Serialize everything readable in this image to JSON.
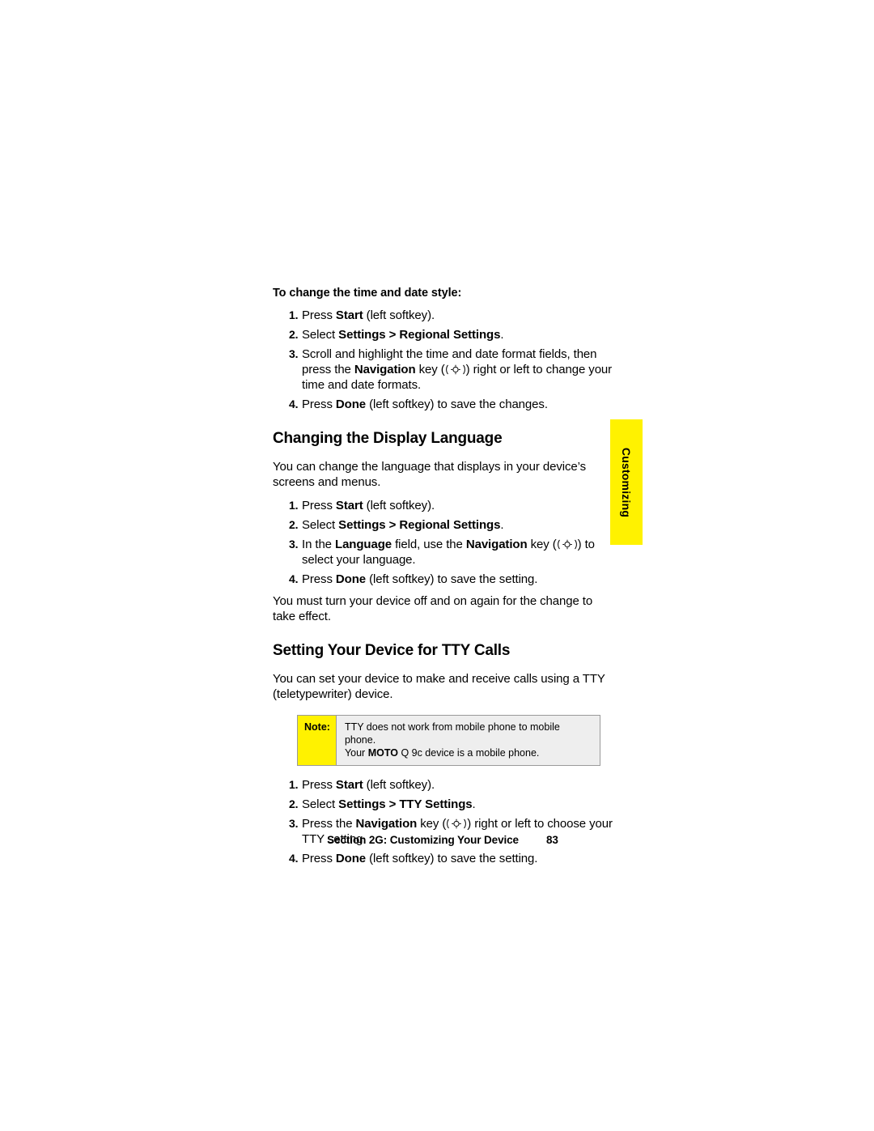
{
  "side_tab": {
    "label": "Customizing",
    "color": "#fff200"
  },
  "intro": {
    "heading": "To change the time and date style:",
    "steps": [
      {
        "num": "1.",
        "html": "Press <b>Start</b> (left softkey)."
      },
      {
        "num": "2.",
        "html": "Select <b>Settings &gt; Regional Settings</b>."
      },
      {
        "num": "3.",
        "html": "Scroll and highlight the time and date format fields, then press the <b>Navigation</b> key (NAVKEY) right or left to change your time and date formats."
      },
      {
        "num": "4.",
        "html": "Press <b>Done</b> (left softkey) to save the changes."
      }
    ]
  },
  "section_language": {
    "title": "Changing the Display Language",
    "para1": "You can change the language that displays in your device’s screens and menus.",
    "steps": [
      {
        "num": "1.",
        "html": "Press <b>Start</b> (left softkey)."
      },
      {
        "num": "2.",
        "html": "Select <b>Settings &gt; Regional Settings</b>."
      },
      {
        "num": "3.",
        "html": "In the <b>Language</b> field, use the <b>Navigation</b> key (NAVKEY) to select your language."
      },
      {
        "num": "4.",
        "html": "Press <b>Done</b> (left softkey) to save the setting."
      }
    ],
    "para2": "You must turn your device off and on again for the change to take effect."
  },
  "section_tty": {
    "title": "Setting Your Device for TTY Calls",
    "para1": "You can set your device to make and receive calls using a TTY (teletypewriter) device.",
    "note": {
      "label": "Note:",
      "line1": "TTY does not work from mobile phone to mobile phone.",
      "line2_html": "Your <b>MOTO</b> Q 9c device is a mobile phone."
    },
    "steps": [
      {
        "num": "1.",
        "html": "Press <b>Start</b> (left softkey)."
      },
      {
        "num": "2.",
        "html": "Select <b>Settings &gt; TTY Settings</b>."
      },
      {
        "num": "3.",
        "html": "Press the <b>Navigation</b> key (NAVKEY) right or left to choose your TTY setting."
      },
      {
        "num": "4.",
        "html": "Press <b>Done</b> (left softkey) to save the setting."
      }
    ]
  },
  "footer": {
    "section": "Section 2G: Customizing Your Device",
    "page": "83"
  }
}
